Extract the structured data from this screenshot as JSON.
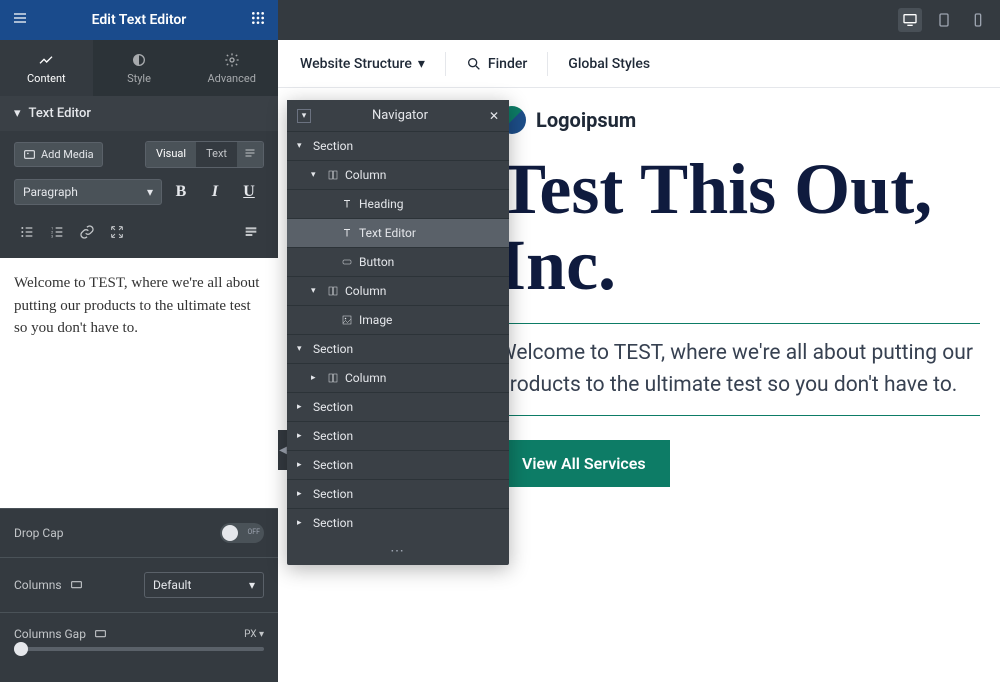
{
  "header": {
    "title": "Edit Text Editor"
  },
  "tabs": {
    "content": "Content",
    "style": "Style",
    "advanced": "Advanced"
  },
  "section": {
    "title": "Text Editor"
  },
  "editor": {
    "addMedia": "Add Media",
    "visualTab": "Visual",
    "textTab": "Text",
    "paragraphSelect": "Paragraph",
    "bold": "B",
    "italic": "I",
    "underline": "U",
    "content": "Welcome to TEST, where we're all about putting our products to the ultimate test so you don't have to."
  },
  "settings": {
    "dropCap": "Drop Cap",
    "dropCapOff": "OFF",
    "columns": "Columns",
    "columnsValue": "Default",
    "columnsGap": "Columns Gap",
    "gapUnit": "PX"
  },
  "canvasToolbar": {
    "websiteStructure": "Website Structure",
    "finder": "Finder",
    "globalStyles": "Global Styles"
  },
  "logo": {
    "text": "Logoipsum"
  },
  "hero": {
    "title": "Test This Out, Inc.",
    "subtitle": "Welcome to TEST, where we're all about putting our products to the ultimate test so you don't have to.",
    "cta": "View All Services"
  },
  "navigator": {
    "title": "Navigator",
    "items": [
      {
        "label": "Section",
        "indent": 0,
        "icon": "caret-down"
      },
      {
        "label": "Column",
        "indent": 1,
        "icon": "caret-down",
        "typeIcon": "column"
      },
      {
        "label": "Heading",
        "indent": 2,
        "typeIcon": "text"
      },
      {
        "label": "Text Editor",
        "indent": 2,
        "typeIcon": "text",
        "selected": true
      },
      {
        "label": "Button",
        "indent": 2,
        "typeIcon": "button"
      },
      {
        "label": "Column",
        "indent": 1,
        "icon": "caret-down",
        "typeIcon": "column"
      },
      {
        "label": "Image",
        "indent": 2,
        "typeIcon": "image"
      },
      {
        "label": "Section",
        "indent": 0,
        "icon": "caret-down"
      },
      {
        "label": "Column",
        "indent": 1,
        "icon": "caret-right",
        "typeIcon": "column"
      },
      {
        "label": "Section",
        "indent": 0,
        "icon": "caret-right"
      },
      {
        "label": "Section",
        "indent": 0,
        "icon": "caret-right"
      },
      {
        "label": "Section",
        "indent": 0,
        "icon": "caret-right"
      },
      {
        "label": "Section",
        "indent": 0,
        "icon": "caret-right"
      },
      {
        "label": "Section",
        "indent": 0,
        "icon": "caret-right"
      }
    ]
  }
}
